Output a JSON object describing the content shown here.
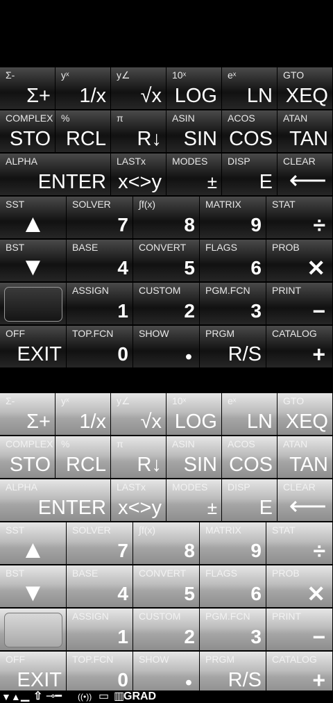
{
  "rows": [
    [
      {
        "shift": "Σ-",
        "main": "Σ+"
      },
      {
        "shift": "yˣ",
        "main": "1/x"
      },
      {
        "shift": "y∠",
        "main": "√x"
      },
      {
        "shift": "10ˣ",
        "main": "LOG"
      },
      {
        "shift": "eˣ",
        "main": "LN"
      },
      {
        "shift": "GTO",
        "main": "XEQ"
      }
    ],
    [
      {
        "shift": "COMPLEX",
        "main": "STO"
      },
      {
        "shift": "%",
        "main": "RCL"
      },
      {
        "shift": "π",
        "main": "R↓"
      },
      {
        "shift": "ASIN",
        "main": "SIN"
      },
      {
        "shift": "ACOS",
        "main": "COS"
      },
      {
        "shift": "ATAN",
        "main": "TAN"
      }
    ],
    [
      {
        "shift": "ALPHA",
        "main": "ENTER"
      },
      {
        "shift": "LASTx",
        "main": "x<>y"
      },
      {
        "shift": "MODES",
        "main": "±"
      },
      {
        "shift": "DISP",
        "main": "E"
      },
      {
        "shift": "CLEAR",
        "main": "⟵"
      }
    ],
    [
      {
        "shift": "SST",
        "main": "▲"
      },
      {
        "shift": "SOLVER",
        "main": "7"
      },
      {
        "shift": "∫f(x)",
        "main": "8"
      },
      {
        "shift": "MATRIX",
        "main": "9"
      },
      {
        "shift": "STAT",
        "main": "÷"
      }
    ],
    [
      {
        "shift": "BST",
        "main": "▼"
      },
      {
        "shift": "BASE",
        "main": "4"
      },
      {
        "shift": "CONVERT",
        "main": "5"
      },
      {
        "shift": "FLAGS",
        "main": "6"
      },
      {
        "shift": "PROB",
        "main": "✕"
      }
    ],
    [
      {
        "shift": "",
        "main": ""
      },
      {
        "shift": "ASSIGN",
        "main": "1"
      },
      {
        "shift": "CUSTOM",
        "main": "2"
      },
      {
        "shift": "PGM.FCN",
        "main": "3"
      },
      {
        "shift": "PRINT",
        "main": "−"
      }
    ],
    [
      {
        "shift": "OFF",
        "main": "EXIT"
      },
      {
        "shift": "TOP.FCN",
        "main": "0"
      },
      {
        "shift": "SHOW",
        "main": "•"
      },
      {
        "shift": "PRGM",
        "main": "R/S"
      },
      {
        "shift": "CATALOG",
        "main": "+"
      }
    ]
  ],
  "status": {
    "arrows": "▼▲",
    "shift_icon": "⇧",
    "print_icon": "⊸━",
    "radio_icon": "((•))",
    "battery_icon": "▭",
    "mode": "GRAD"
  }
}
